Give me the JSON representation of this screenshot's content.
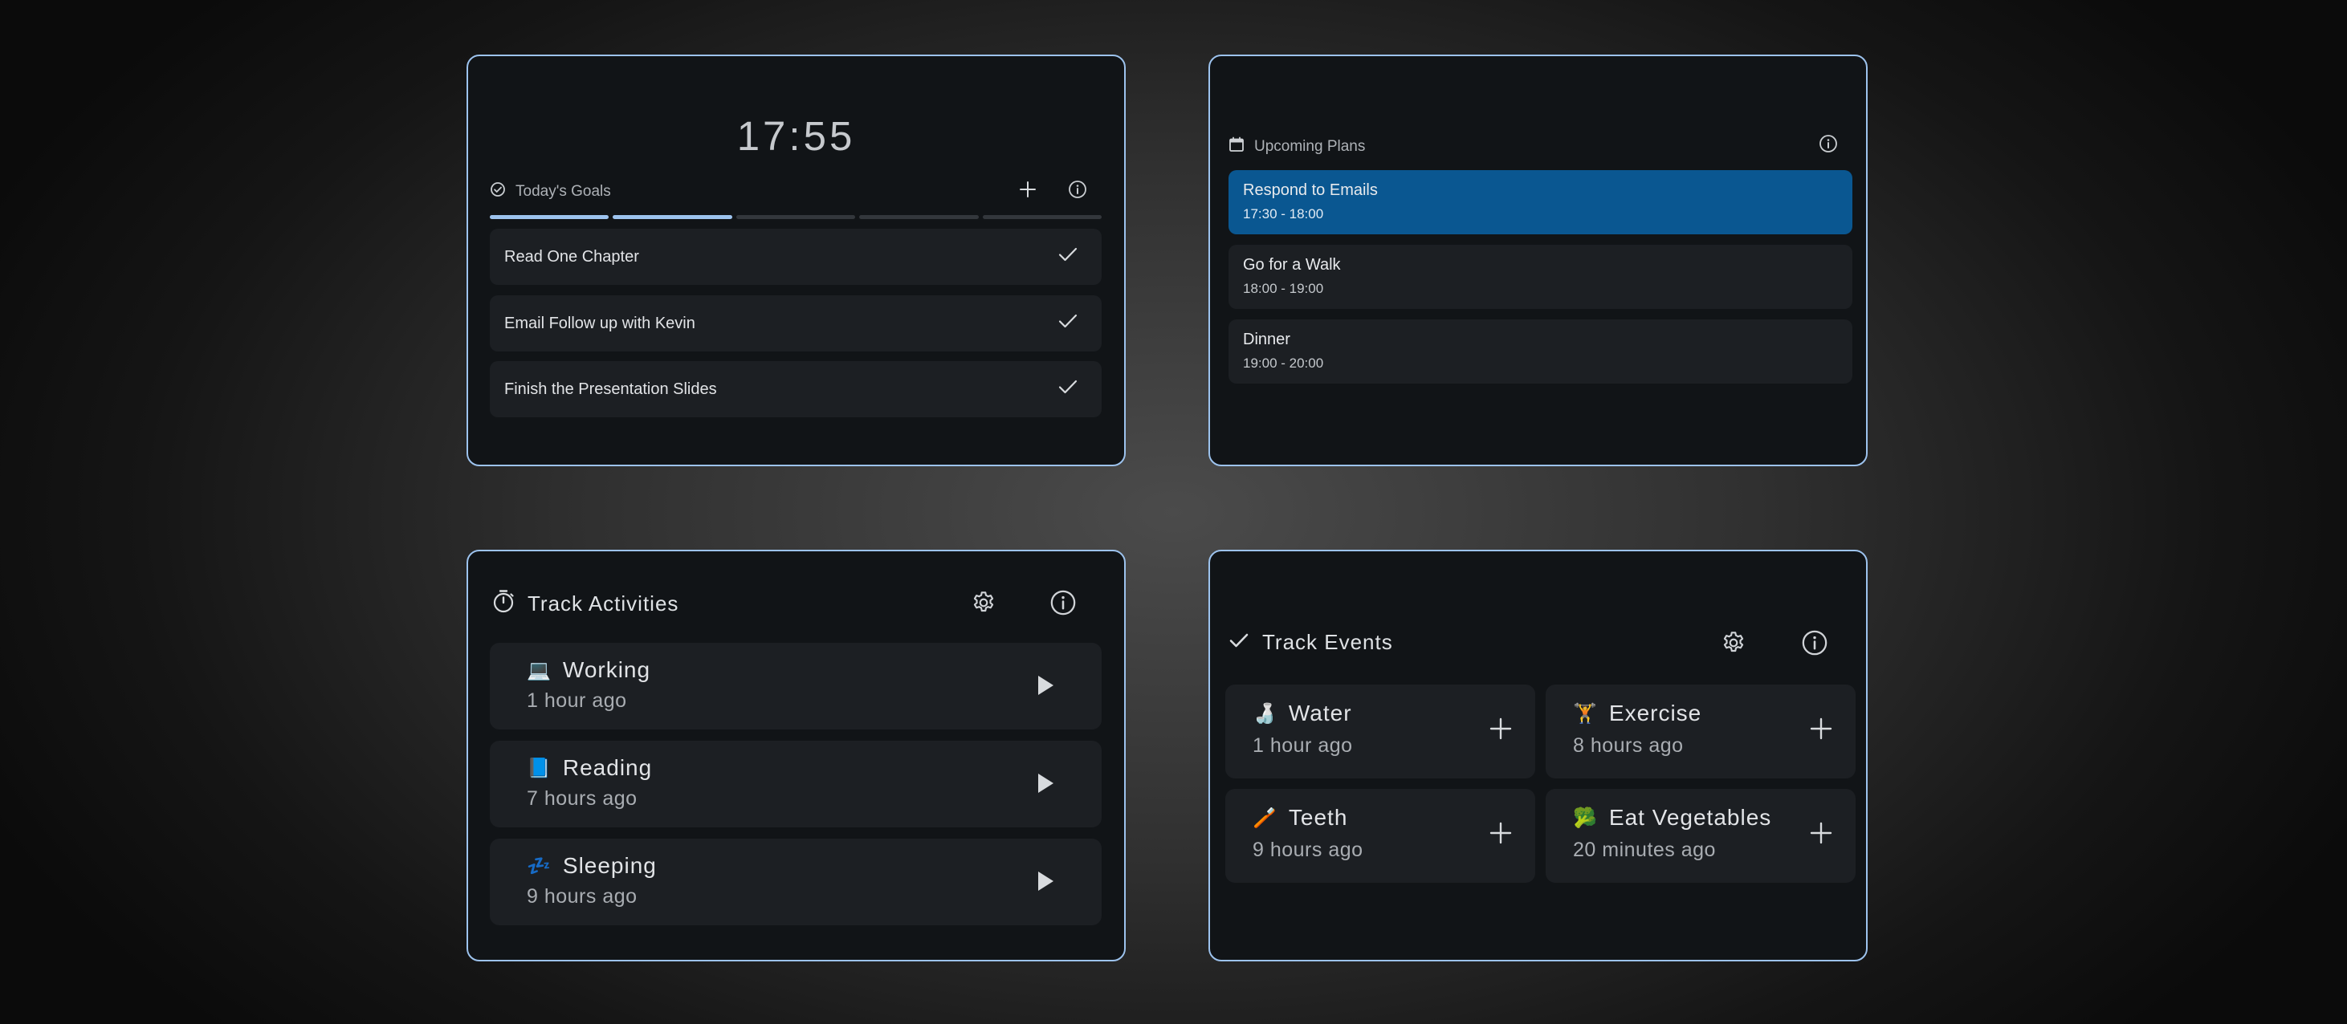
{
  "goals": {
    "clock": "17:55",
    "title": "Today's Goals",
    "progress": {
      "completed": 2,
      "total": 5
    },
    "items": [
      {
        "label": "Read One Chapter"
      },
      {
        "label": "Email Follow up with Kevin"
      },
      {
        "label": "Finish the Presentation Slides"
      }
    ]
  },
  "plans": {
    "title": "Upcoming Plans",
    "items": [
      {
        "title": "Respond to Emails",
        "time": "17:30 - 18:00",
        "active": true
      },
      {
        "title": "Go for a Walk",
        "time": "18:00 - 19:00"
      },
      {
        "title": "Dinner",
        "time": "19:00 - 20:00"
      }
    ]
  },
  "activities": {
    "title": "Track Activities",
    "items": [
      {
        "emoji": "💻",
        "label": "Working",
        "ago": "1 hour ago"
      },
      {
        "emoji": "📘",
        "label": "Reading",
        "ago": "7 hours ago"
      },
      {
        "emoji": "💤",
        "label": "Sleeping",
        "ago": "9 hours ago"
      }
    ]
  },
  "events": {
    "title": "Track Events",
    "items": [
      {
        "emoji": "🍶",
        "label": "Water",
        "ago": "1 hour ago"
      },
      {
        "emoji": "🏋",
        "label": "Exercise",
        "ago": "8 hours ago"
      },
      {
        "emoji": "🪥",
        "label": "Teeth",
        "ago": "9 hours ago"
      },
      {
        "emoji": "🥦",
        "label": "Eat Vegetables",
        "ago": "20 minutes ago"
      }
    ]
  },
  "icons": {
    "goals_header": "check-circle-icon",
    "add": "plus-icon",
    "info": "info-icon",
    "complete": "checkmark-icon",
    "calendar": "calendar-icon",
    "timer": "stopwatch-icon",
    "settings": "gear-icon",
    "play": "play-icon",
    "events_header": "checkmark-icon"
  },
  "colors": {
    "card_border": "#9dc3ee",
    "card_bg": "#111417",
    "row_bg": "#1c1f23",
    "active_plan": "#0a5791",
    "progress_done": "#9dc3ee",
    "progress_todo": "#33373c"
  }
}
